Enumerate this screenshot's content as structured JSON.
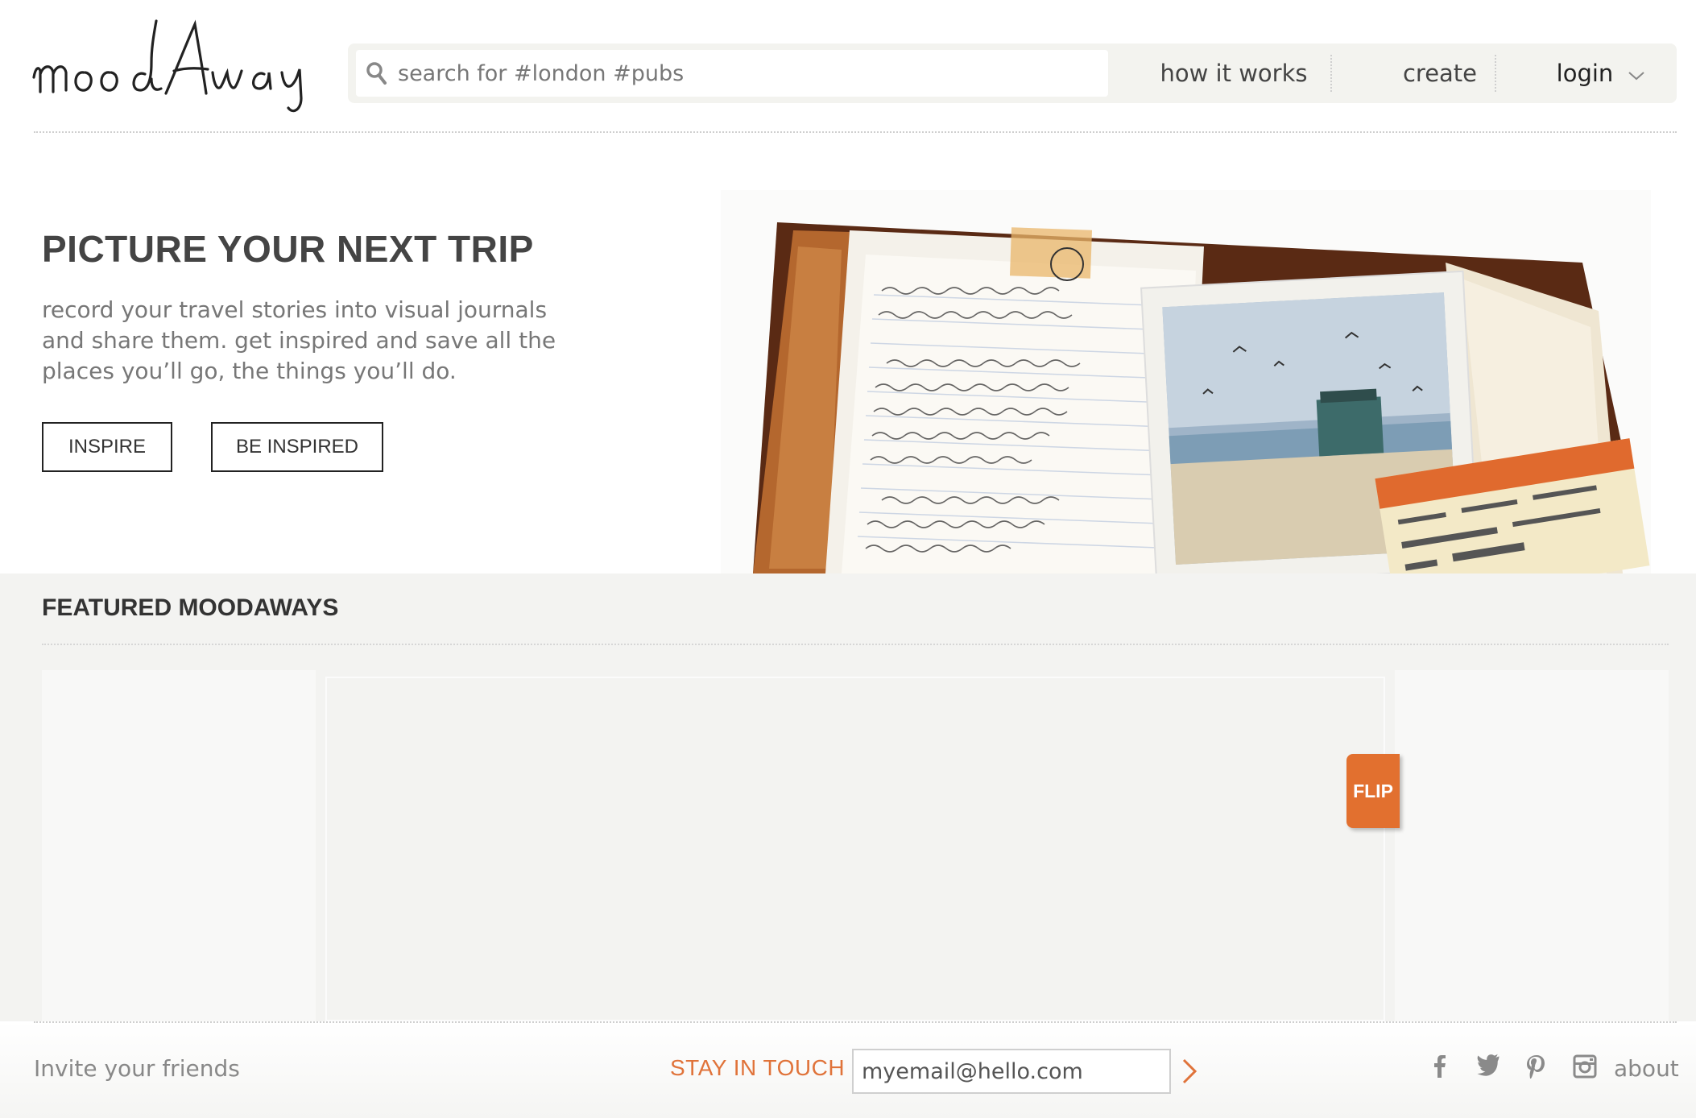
{
  "header": {
    "logo_alt": "moodAway",
    "search_placeholder": "search for #london #pubs",
    "nav": {
      "how": "how it works",
      "create": "create",
      "login": "login"
    }
  },
  "hero": {
    "title": "PICTURE YOUR NEXT TRIP",
    "description": "record your travel stories into visual journals and share them. get inspired and save all the places you’ll go, the things you’ll do.",
    "btn_inspire": "INSPIRE",
    "btn_be_inspired": "BE INSPIRED"
  },
  "featured": {
    "title": "FEATURED MOODAWAYS",
    "flip_label": "FLIP"
  },
  "footer": {
    "invite": "Invite your friends",
    "stay_in_touch": "STAY IN TOUCH",
    "email_value": "myemail@hello.com",
    "about": "about",
    "social_icons": [
      "facebook-icon",
      "twitter-icon",
      "pinterest-icon",
      "instagram-icon"
    ]
  },
  "colors": {
    "accent": "#e2702f",
    "navbar_bg": "#f3f3ef",
    "featured_bg": "#f3f3f1"
  }
}
